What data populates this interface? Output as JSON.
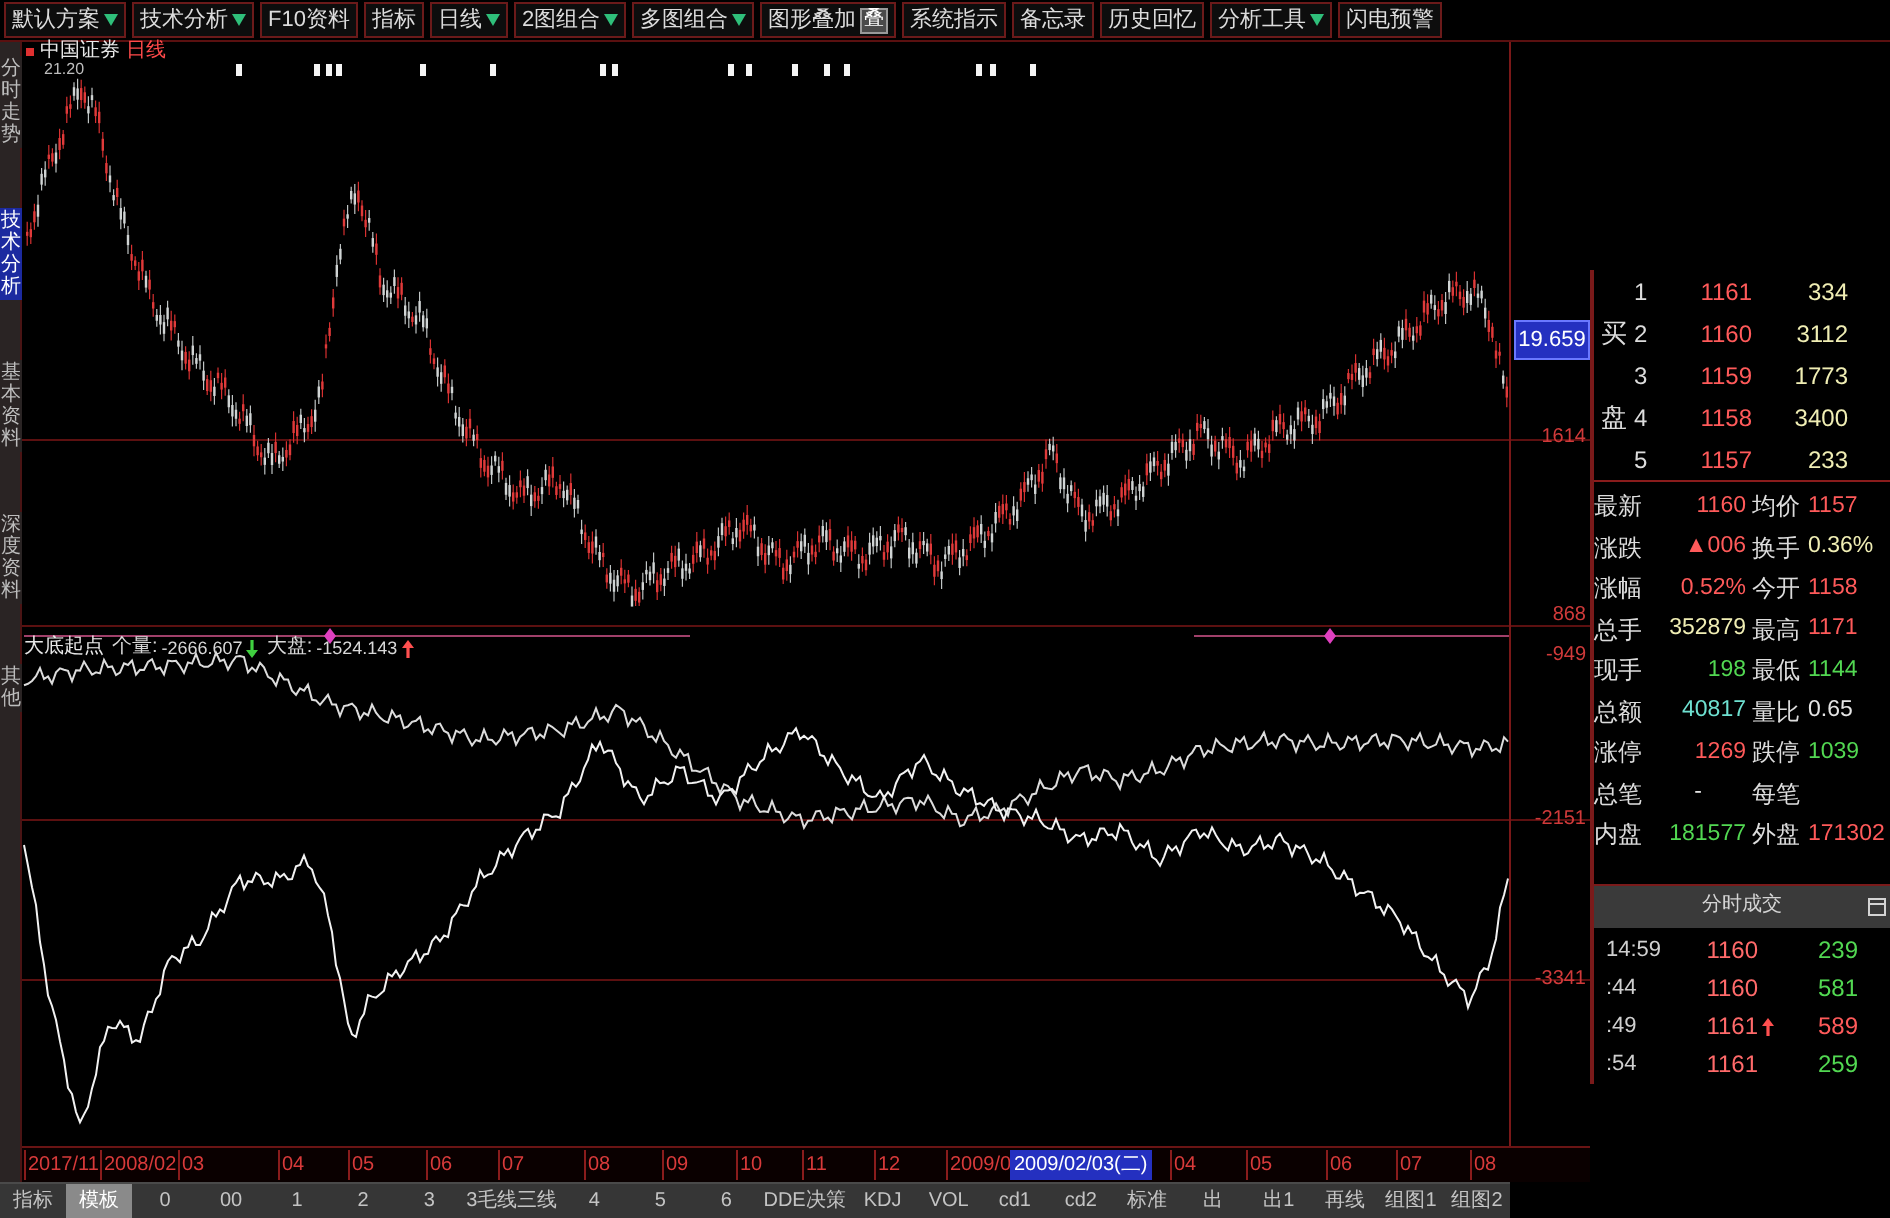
{
  "toolbar": [
    {
      "label": "默认方案",
      "menu": true
    },
    {
      "label": "技术分析",
      "menu": true
    },
    {
      "label": "F10资料",
      "menu": false
    },
    {
      "label": "指标",
      "menu": false
    },
    {
      "label": "日线",
      "menu": true
    },
    {
      "label": "2图组合",
      "menu": true
    },
    {
      "label": "多图组合",
      "menu": true
    },
    {
      "label": "图形叠加",
      "menu": false,
      "badge": "叠"
    },
    {
      "label": "系统指示",
      "menu": false
    },
    {
      "label": "备忘录",
      "menu": false
    },
    {
      "label": "历史回忆",
      "menu": false
    },
    {
      "label": "分析工具",
      "menu": true
    },
    {
      "label": "闪电预警",
      "menu": false
    }
  ],
  "sidebar": {
    "tabs": [
      {
        "label": "分时走势",
        "selected": false
      },
      {
        "label": "技术分析",
        "selected": true
      },
      {
        "label": "基本资料",
        "selected": false
      },
      {
        "label": "深度资料",
        "selected": false
      },
      {
        "label": "其他",
        "selected": false
      }
    ]
  },
  "chart": {
    "title": "中国证券",
    "period": "日线",
    "price": "21.20",
    "axis": [
      {
        "text": "19.659",
        "kind": "cursor"
      },
      {
        "text": "1614",
        "kind": "tick"
      },
      {
        "text": "868",
        "kind": "tick"
      },
      {
        "text": "-949",
        "kind": "tick"
      },
      {
        "text": "-2151",
        "kind": "tick"
      },
      {
        "text": "-3341",
        "kind": "tick"
      }
    ],
    "indicator": {
      "name": "大底起点",
      "values": [
        {
          "label": "个量:",
          "value": "-2666.607",
          "rising": false
        },
        {
          "label": "大盘:",
          "value": "-1524.143",
          "rising": true
        }
      ]
    }
  },
  "dates": [
    {
      "text": "2017/11",
      "kind": "tick"
    },
    {
      "text": "2008/02",
      "kind": "tick"
    },
    {
      "text": "03",
      "kind": "tick"
    },
    {
      "text": "04",
      "kind": "tick"
    },
    {
      "text": "05",
      "kind": "tick"
    },
    {
      "text": "06",
      "kind": "tick"
    },
    {
      "text": "07",
      "kind": "tick"
    },
    {
      "text": "08",
      "kind": "tick"
    },
    {
      "text": "09",
      "kind": "tick"
    },
    {
      "text": "10",
      "kind": "tick"
    },
    {
      "text": "11",
      "kind": "tick"
    },
    {
      "text": "12",
      "kind": "tick"
    },
    {
      "text": "2009/0",
      "kind": "tick"
    },
    {
      "text": "2009/02/03(二)",
      "kind": "cursor"
    },
    {
      "text": "04",
      "kind": "tick"
    },
    {
      "text": "05",
      "kind": "tick"
    },
    {
      "text": "06",
      "kind": "tick"
    },
    {
      "text": "07",
      "kind": "tick"
    },
    {
      "text": "08",
      "kind": "tick"
    }
  ],
  "indicator_tabs": [
    {
      "label": "指标",
      "selected": false
    },
    {
      "label": "模板",
      "selected": true
    },
    {
      "label": "0",
      "selected": false
    },
    {
      "label": "00",
      "selected": false
    },
    {
      "label": "1",
      "selected": false
    },
    {
      "label": "2",
      "selected": false
    },
    {
      "label": "3",
      "selected": false
    },
    {
      "label": "3毛线三线",
      "selected": false
    },
    {
      "label": "4",
      "selected": false
    },
    {
      "label": "5",
      "selected": false
    },
    {
      "label": "6",
      "selected": false
    },
    {
      "label": "DDE决策",
      "selected": false
    },
    {
      "label": "KDJ",
      "selected": false
    },
    {
      "label": "VOL",
      "selected": false
    },
    {
      "label": "cd1",
      "selected": false
    },
    {
      "label": "cd2",
      "selected": false
    },
    {
      "label": "标准",
      "selected": false
    },
    {
      "label": "出",
      "selected": false
    },
    {
      "label": "出1",
      "selected": false
    },
    {
      "label": "再线",
      "selected": false
    },
    {
      "label": "组图1",
      "selected": false
    },
    {
      "label": "组图2",
      "selected": false
    }
  ],
  "quote": {
    "bids": {
      "label_top": "买",
      "label_bottom": "盘",
      "rows": [
        {
          "no": "1",
          "price": "1161",
          "volume": "334"
        },
        {
          "no": "2",
          "price": "1160",
          "volume": "3112"
        },
        {
          "no": "3",
          "price": "1159",
          "volume": "1773"
        },
        {
          "no": "4",
          "price": "1158",
          "volume": "3400"
        },
        {
          "no": "5",
          "price": "1157",
          "volume": "233"
        }
      ]
    },
    "stats": [
      {
        "label": "最新",
        "value": "1160",
        "color": "#ff5a5a"
      },
      {
        "label": "均价",
        "value": "1157",
        "color": "#ff5a5a"
      },
      {
        "label": "涨跌",
        "value": "▲006",
        "color": "#ff5a5a"
      },
      {
        "label": "换手",
        "value": "0.36%",
        "color": "#f0eeb4"
      },
      {
        "label": "涨幅",
        "value": "0.52%",
        "color": "#ff5a5a"
      },
      {
        "label": "今开",
        "value": "1158",
        "color": "#ff5a5a"
      },
      {
        "label": "总手",
        "value": "352879",
        "color": "#f0eeb4"
      },
      {
        "label": "最高",
        "value": "1171",
        "color": "#ff5a5a"
      },
      {
        "label": "现手",
        "value": "198",
        "color": "#52d852"
      },
      {
        "label": "最低",
        "value": "1144",
        "color": "#52d852"
      },
      {
        "label": "总额",
        "value": "40817",
        "color": "#6ee0d0"
      },
      {
        "label": "量比",
        "value": "0.65",
        "color": "#e4e4e4"
      },
      {
        "label": "涨停",
        "value": "1269",
        "color": "#ff5a5a"
      },
      {
        "label": "跌停",
        "value": "1039",
        "color": "#52d852"
      },
      {
        "label": "总笔",
        "value": "-",
        "color": "#e4e4e4"
      },
      {
        "label": "每笔"
      },
      {
        "label": "内盘",
        "value": "181577",
        "color": "#52d852"
      },
      {
        "label": "外盘",
        "value": "171302",
        "color": "#ff5a5a"
      }
    ],
    "trades": {
      "title": "分时成交",
      "rows": [
        {
          "time": "14:59",
          "price": "1160",
          "volume": "239",
          "buy": false,
          "up_tick": false
        },
        {
          "time": ":44",
          "price": "1160",
          "volume": "581",
          "buy": false,
          "up_tick": false
        },
        {
          "time": ":49",
          "price": "1161",
          "volume": "589",
          "buy": true,
          "up_tick": true
        },
        {
          "time": ":54",
          "price": "1161",
          "volume": "259",
          "buy": false,
          "up_tick": false
        }
      ]
    }
  }
}
